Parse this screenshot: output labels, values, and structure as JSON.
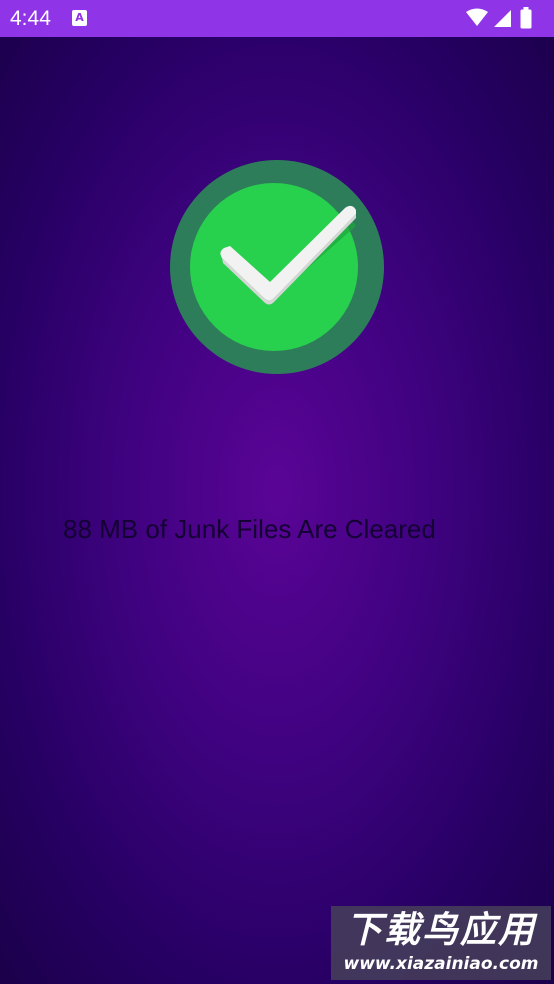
{
  "status_bar": {
    "time": "4:44",
    "notification_icon": "A",
    "icons": [
      "notification-a-icon",
      "wifi-icon",
      "signal-icon",
      "battery-icon"
    ],
    "background": "#9034e8"
  },
  "main": {
    "success_icon": "checkmark-circle-icon",
    "message": "88 MB of Junk Files Are Cleared",
    "colors": {
      "outer_ring": "#2e7d5a",
      "inner_circle": "#28d14d",
      "check": "#f2f2f2"
    }
  },
  "watermark": {
    "title": "下载鸟应用",
    "url": "www.xiazainiao.com"
  }
}
